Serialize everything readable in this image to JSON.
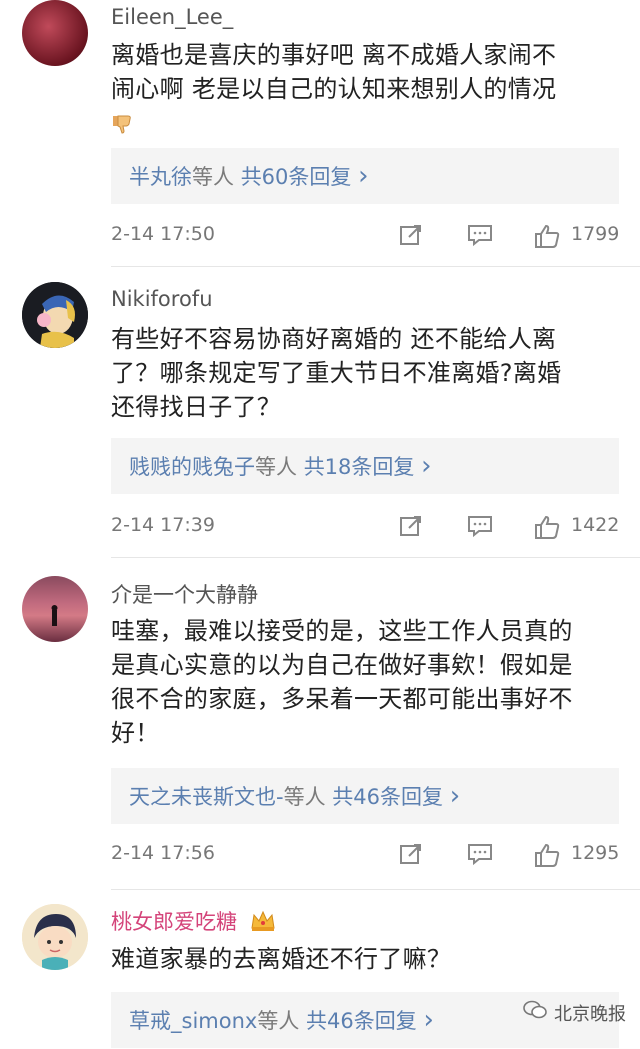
{
  "comments": [
    {
      "user": "Eileen_Lee_",
      "lines": [
        "离婚也是喜庆的事好吧 离不成婚人家闹不",
        "闹心啊 老是以自己的认知来想别人的情况"
      ],
      "emoji": "thumbs-down-emoji",
      "reply_users": "半丸徐",
      "reply_mid": "等人",
      "reply_total": "共60条回复",
      "time": "2-14 17:50",
      "likes": "1799"
    },
    {
      "user": "Nikiforofu",
      "lines": [
        "有些好不容易协商好离婚的 还不能给人离",
        "了？哪条规定写了重大节日不准离婚?离婚",
        "还得找日子了？"
      ],
      "reply_users": "贱贱的贱兔子",
      "reply_mid": "等人",
      "reply_total": "共18条回复",
      "time": "2-14 17:39",
      "likes": "1422"
    },
    {
      "user": "介是一个大静静",
      "lines": [
        "哇塞，最难以接受的是，这些工作人员真的",
        "是真心实意的以为自己在做好事欸！假如是",
        "很不合的家庭，多呆着一天都可能出事好不",
        "好！"
      ],
      "reply_users": "天之未丧斯文也-",
      "reply_mid": "等人",
      "reply_total": "共46条回复",
      "time": "2-14 17:56",
      "likes": "1295"
    },
    {
      "user": "桃女郎爱吃糖",
      "lines": [
        "难道家暴的去离婚还不行了嘛？"
      ],
      "reply_users": "草戒_simonx",
      "reply_mid": "等人",
      "reply_total": "共46条回复"
    }
  ],
  "chevron": "›",
  "watermark": "北京晚报",
  "colors": {
    "link": "#5b7fb0",
    "pink_user": "#d4447a",
    "reply_bg": "#f4f4f4"
  }
}
